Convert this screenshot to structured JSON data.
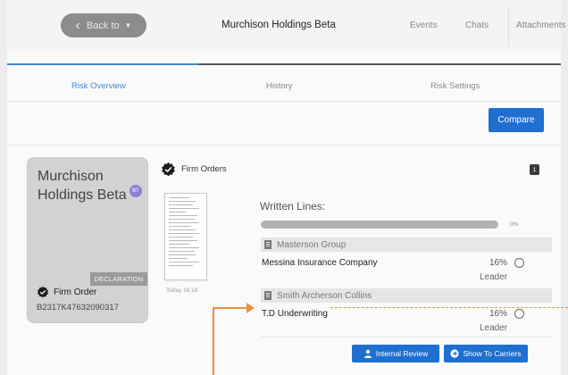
{
  "topbar": {
    "back_label": "Back to",
    "title": "Murchison Holdings Beta",
    "nav": [
      "Events",
      "Chats",
      "Attachments"
    ]
  },
  "tabs": [
    "Risk Overview",
    "History",
    "Risk Settings"
  ],
  "compare_label": "Compare",
  "card": {
    "title": "Murchison Holdings Beta",
    "badge": "BT",
    "tag": "DECLARATION",
    "order_label": "Firm Order",
    "order_code": "B2317K47632090317"
  },
  "firm_orders": {
    "title": "Firm Orders",
    "count": "1",
    "doc_date": "Today 16:19"
  },
  "written_lines": {
    "title": "Written Lines:",
    "progress_percent": 0,
    "progress_label": "0%",
    "groups": [
      {
        "name": "Masterson Group",
        "line": {
          "insurer": "Messina Insurance Company",
          "percent": "16%",
          "role": "Leader"
        }
      },
      {
        "name": "Smith Archerson Collins",
        "line": {
          "insurer": "T.D Underwriting",
          "percent": "16%",
          "role": "Leader"
        }
      }
    ]
  },
  "actions": {
    "internal_review": "Internal Review",
    "show_to_carriers": "Show To Carriers"
  },
  "colors": {
    "accent": "#1f6fd1",
    "tab_active": "#3c8ad8",
    "annotation": "#e8913a"
  }
}
